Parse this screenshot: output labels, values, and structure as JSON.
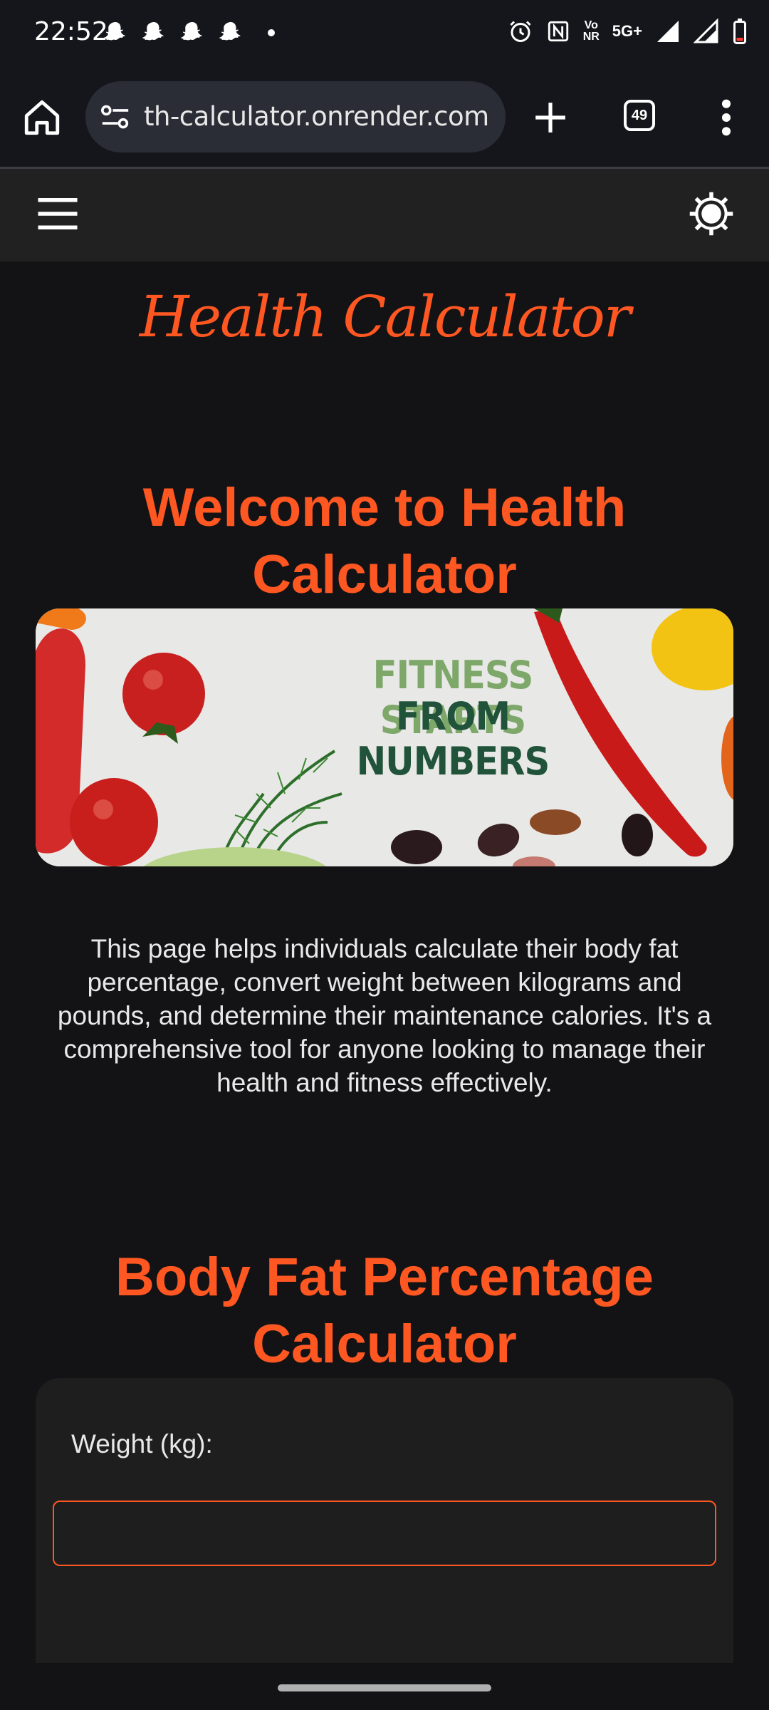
{
  "status_bar": {
    "time": "22:52",
    "network_label_1": "Vo",
    "network_label_2": "NR",
    "network_type": "5G+",
    "icons": [
      "snapchat-icon",
      "snapchat-icon",
      "snapchat-icon",
      "snapchat-icon",
      "dot-icon",
      "alarm-icon",
      "nfc-icon",
      "signal-icon",
      "signal-icon",
      "battery-icon"
    ]
  },
  "browser": {
    "url": "th-calculator.onrender.com",
    "tab_count": "49",
    "icons": [
      "home-icon",
      "site-settings-icon",
      "plus-icon",
      "tabs-icon",
      "more-vert-icon"
    ]
  },
  "appbar": {
    "icons": [
      "hamburger-menu-icon",
      "sun-theme-icon"
    ]
  },
  "logo": "Health Calculator",
  "welcome": {
    "title": "Welcome to Health Calculator",
    "banner_line1": "FITNESS STARTS",
    "banner_line2": "FROM NUMBERS",
    "description": "This page helps individuals calculate their body fat percentage, convert weight between kilograms and pounds, and determine their maintenance calories. It's a comprehensive tool for anyone looking to manage their health and fitness effectively."
  },
  "body_fat": {
    "title": "Body Fat Percentage Calculator",
    "weight_label": "Weight (kg):",
    "weight_value": ""
  },
  "colors": {
    "accent": "#ff5722",
    "background": "#131315",
    "card": "#1e1e1f",
    "appbar": "#212121"
  }
}
